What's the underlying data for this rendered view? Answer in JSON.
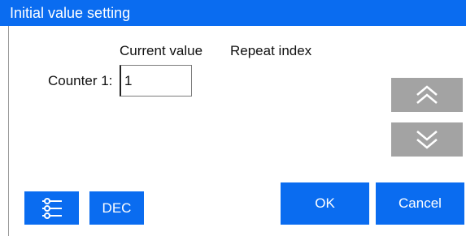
{
  "dialog": {
    "title": "Initial value setting"
  },
  "headers": {
    "current_value": "Current value",
    "repeat_index": "Repeat index"
  },
  "counter": {
    "label": "Counter 1:",
    "value": "1"
  },
  "scroll": {
    "up_icon": "double-chevron-up-icon",
    "down_icon": "double-chevron-down-icon"
  },
  "buttons": {
    "menu_icon": "settings-sliders-icon",
    "dec_label": "DEC",
    "ok_label": "OK",
    "cancel_label": "Cancel"
  },
  "colors": {
    "accent": "#0a6cf0",
    "scroll_button": "#a3a3a3",
    "background": "#ffffff"
  }
}
